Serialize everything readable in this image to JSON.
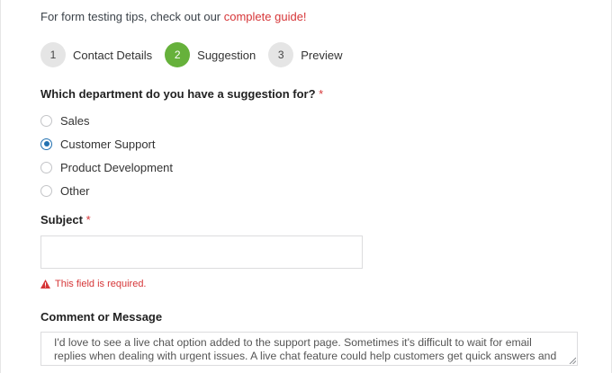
{
  "tip": {
    "text": "For form testing tips, check out our ",
    "link": "complete guide!"
  },
  "steps": [
    {
      "num": "1",
      "label": "Contact Details",
      "state": "done"
    },
    {
      "num": "2",
      "label": "Suggestion",
      "state": "active"
    },
    {
      "num": "3",
      "label": "Preview",
      "state": "pending"
    }
  ],
  "department": {
    "label": "Which department do you have a suggestion for?",
    "required": "*",
    "options": [
      "Sales",
      "Customer Support",
      "Product Development",
      "Other"
    ],
    "selected": "Customer Support"
  },
  "subject": {
    "label": "Subject",
    "required": "*",
    "value": "",
    "error": "This field is required."
  },
  "comment": {
    "label": "Comment or Message",
    "value": "I'd love to see a live chat option added to the support page. Sometimes it's difficult to wait for email replies when dealing with urgent issues. A live chat feature could help customers get quick answers and improve"
  },
  "colors": {
    "accent": "#66b13b",
    "error": "#d63638",
    "radio": "#2271b1"
  },
  "icons": {
    "error": "warning-triangle-icon",
    "resize": "resize-grip-icon"
  }
}
